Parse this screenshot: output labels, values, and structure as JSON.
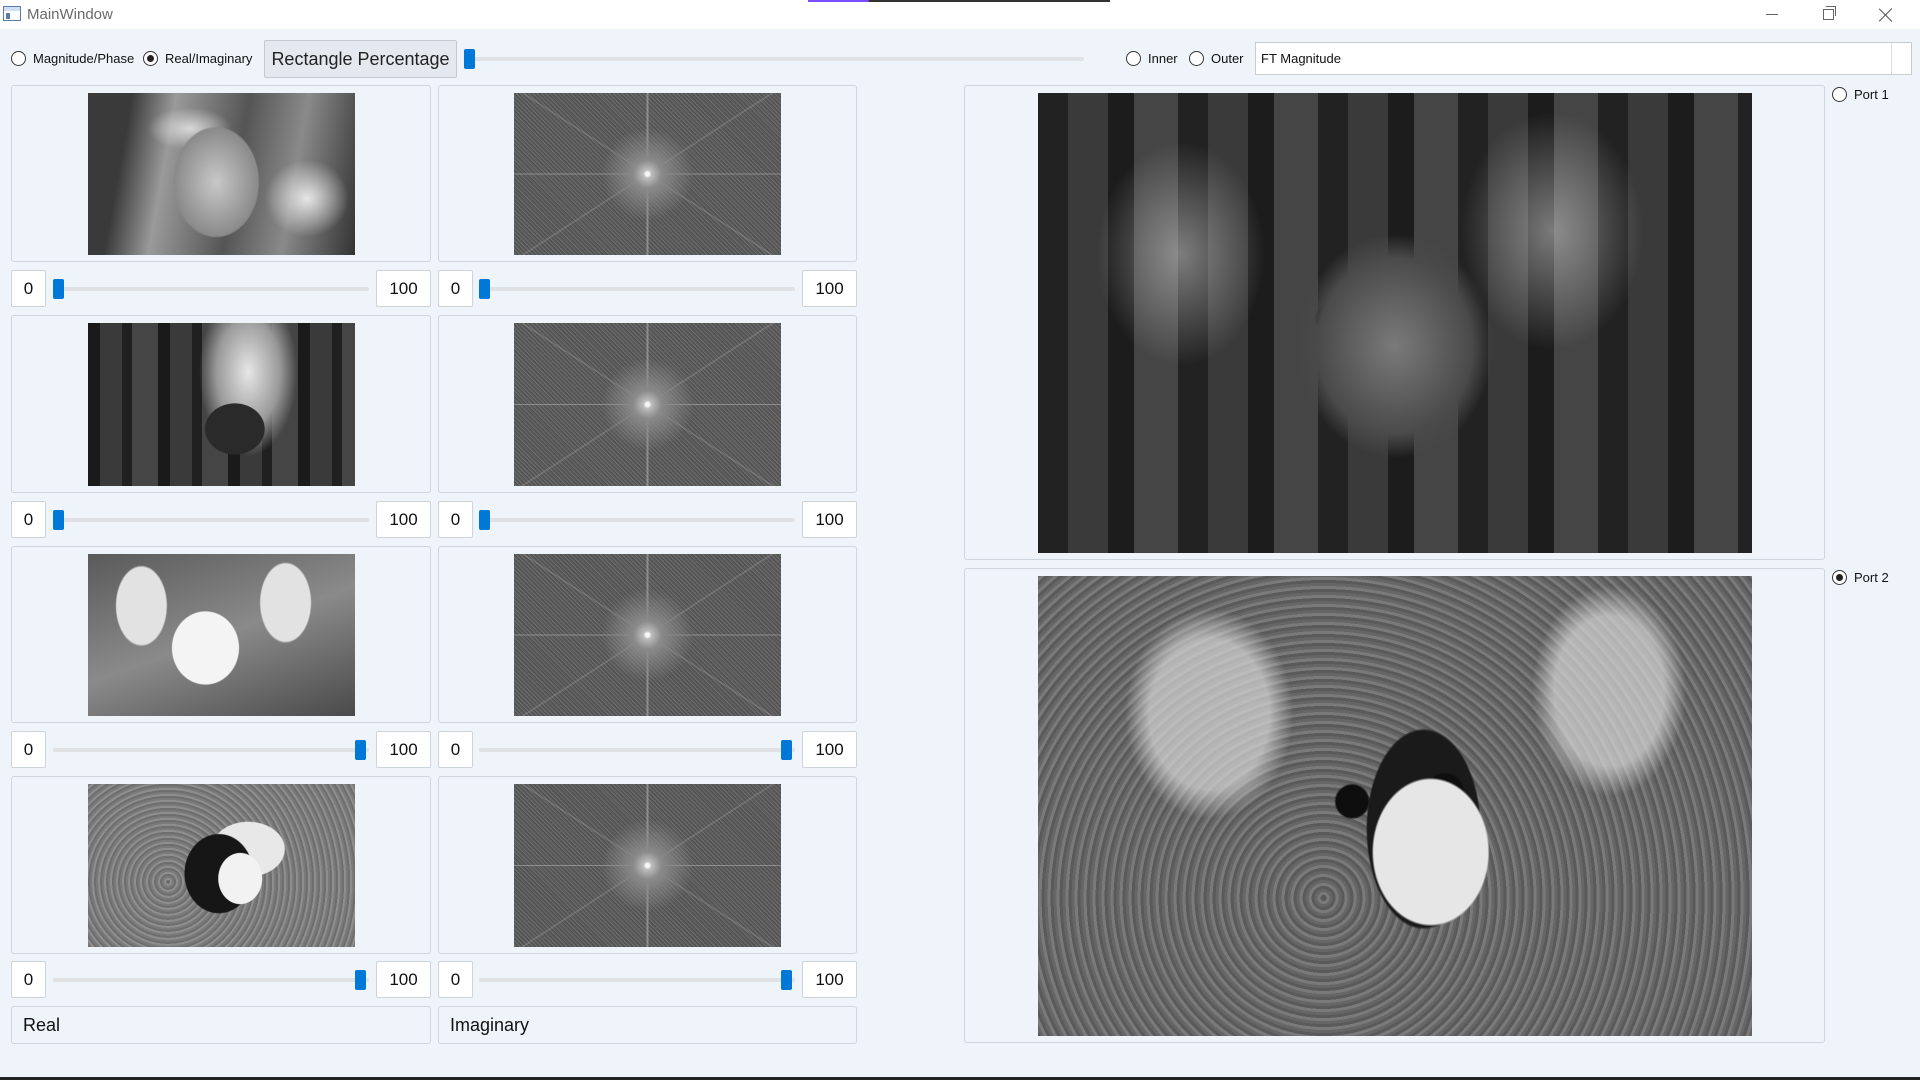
{
  "window": {
    "title": "MainWindow"
  },
  "toolbar": {
    "mode_magnitude_phase": "Magnitude/Phase",
    "mode_real_imaginary": "Real/Imaginary",
    "rectangle_button": "Rectangle Percentage",
    "rectangle_value": 0,
    "region_inner": "Inner",
    "region_outer": "Outer",
    "component_select": "FT Magnitude"
  },
  "images": [
    {
      "name": "woman-hat",
      "ft_name": "fft-1",
      "weight_left_min": "0",
      "weight_left_max": "100",
      "weight_left_value": 0,
      "weight_right_min": "0",
      "weight_right_max": "100",
      "weight_right_value": 0
    },
    {
      "name": "elephant",
      "ft_name": "fft-2",
      "weight_left_min": "0",
      "weight_left_max": "100",
      "weight_left_value": 0,
      "weight_right_min": "0",
      "weight_right_max": "100",
      "weight_right_value": 0
    },
    {
      "name": "fennec-fox",
      "ft_name": "fft-3",
      "weight_left_min": "0",
      "weight_left_max": "100",
      "weight_left_value": 100,
      "weight_right_min": "0",
      "weight_right_max": "100",
      "weight_right_value": 100
    },
    {
      "name": "panda",
      "ft_name": "fft-4",
      "weight_left_min": "0",
      "weight_left_max": "100",
      "weight_left_value": 100,
      "weight_right_min": "0",
      "weight_right_max": "100",
      "weight_right_value": 100
    }
  ],
  "columns": {
    "left_label": "Real",
    "right_label": "Imaginary"
  },
  "output": {
    "port1": "Port 1",
    "port2": "Port 2",
    "selected": "Port 2"
  }
}
